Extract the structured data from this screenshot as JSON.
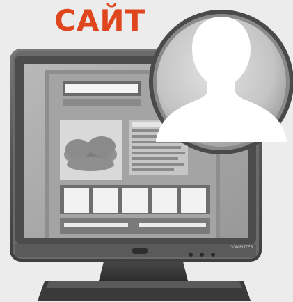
{
  "title": {
    "text": "САЙТ",
    "color": "#e0461e"
  },
  "monitor": {
    "brand_label": "COMPUTER",
    "screen_color": "#a8a8a8",
    "bezel_color": "#5e5e5e"
  },
  "avatar": {
    "icon": "user-silhouette-icon"
  },
  "webpage_mock": {
    "thumbnail_count": 5,
    "footer_bar_count": 2
  }
}
